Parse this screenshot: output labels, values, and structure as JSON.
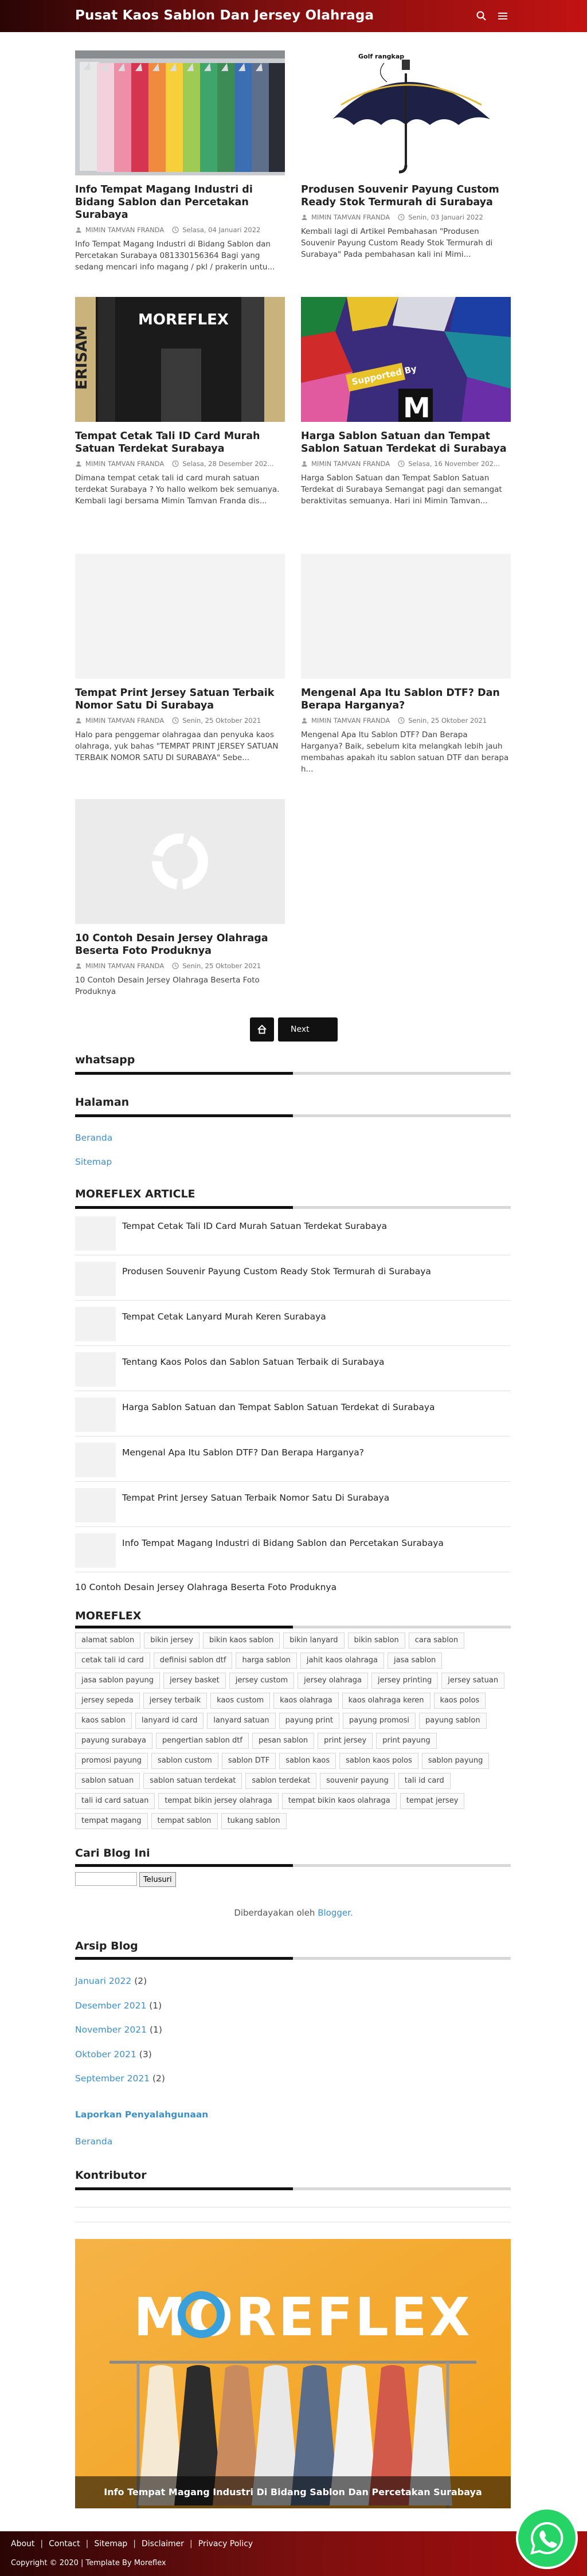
{
  "header": {
    "site_title": "Pusat Kaos Sablon Dan Jersey Olahraga"
  },
  "posts": [
    {
      "title": "Info Tempat Magang Industri di Bidang Sablon dan Percetakan Surabaya",
      "author": "MIMIN TAMVAN FRANDA",
      "date": "Selasa, 04 Januari 2022",
      "excerpt": "Info Tempat Magang Industri di Bidang Sablon dan Percetakan Surabaya 081330156364 Bagi yang sedang mencari info magang / pkl / prakerin untu..."
    },
    {
      "title": "Produsen Souvenir Payung Custom Ready Stok Termurah di Surabaya",
      "author": "MIMIN TAMVAN FRANDA",
      "date": "Senin, 03 Januari 2022",
      "excerpt": "Kembali lagi di Artikel Pembahasan \"Produsen Souvenir Payung Custom Ready Stok Termurah di Surabaya\" Pada pembahasan kali ini Mimi...",
      "image_text": "Golf rangkap"
    },
    {
      "title": "Tempat Cetak Tali ID Card Murah Satuan Terdekat Surabaya",
      "author": "MIMIN TAMVAN FRANDA",
      "date": "Selasa, 28 Desember 202...",
      "excerpt": "Dimana tempat cetak tali id card murah satuan terdekat Surabaya ? Yo hallo welkom bek semuanya. Kembali lagi bersama Mimin Tamvan Franda dis...",
      "image_text": "MOREFLEX"
    },
    {
      "title": "Harga Sablon Satuan dan Tempat Sablon Satuan Terdekat di Surabaya",
      "author": "MIMIN TAMVAN FRANDA",
      "date": "Selasa, 16 November 202...",
      "excerpt": "Harga Sablon Satuan dan Tempat Sablon Satuan Terdekat di Surabaya   Semangat pagi dan semangat beraktivitas semuanya. Hari ini Mimin Tamvan...",
      "image_text": "Supported By"
    },
    {
      "title": "Tempat Print Jersey Satuan Terbaik Nomor Satu Di Surabaya",
      "author": "MIMIN TAMVAN FRANDA",
      "date": "Senin, 25 Oktober 2021",
      "excerpt": "Halo para penggemar olahragaa dan penyuka kaos olahraga, yuk bahas \"TEMPAT PRINT JERSEY SATUAN TERBAIK NOMOR SATU DI SURABAYA\" Sebe..."
    },
    {
      "title": "Mengenal Apa Itu Sablon DTF? Dan Berapa Harganya?",
      "author": "MIMIN TAMVAN FRANDA",
      "date": "Senin, 25 Oktober 2021",
      "excerpt": "Mengenal Apa Itu Sablon DTF? Dan Berapa Harganya? Baik, sebelum kita melangkah lebih jauh membahas apakah itu sablon satuan DTF dan berapa h..."
    },
    {
      "title": "10 Contoh Desain Jersey Olahraga Beserta Foto Produknya",
      "author": "MIMIN TAMVAN FRANDA",
      "date": "Senin, 25 Oktober 2021",
      "excerpt": "10 Contoh Desain Jersey Olahraga Beserta Foto Produknya"
    }
  ],
  "pagination": {
    "next_label": "Next"
  },
  "widgets": {
    "whatsapp_title": "whatsapp",
    "halaman_title": "Halaman",
    "halaman_links": [
      "Beranda",
      "Sitemap"
    ],
    "article_title": "MOREFLEX ARTICLE",
    "articles": [
      "Tempat Cetak Tali ID Card Murah Satuan Terdekat Surabaya",
      "Produsen Souvenir Payung Custom Ready Stok Termurah di Surabaya",
      "Tempat Cetak Lanyard Murah Keren Surabaya",
      "Tentang Kaos Polos dan Sablon Satuan Terbaik di Surabaya",
      "Harga Sablon Satuan dan Tempat Sablon Satuan Terdekat di Surabaya",
      "Mengenal Apa Itu Sablon DTF? Dan Berapa Harganya?",
      "Tempat Print Jersey Satuan Terbaik Nomor Satu Di Surabaya",
      "Info Tempat Magang Industri di Bidang Sablon dan Percetakan Surabaya"
    ],
    "article_last": "10 Contoh Desain Jersey Olahraga Beserta Foto Produknya",
    "labels_title": "MOREFLEX",
    "labels": [
      "alamat sablon",
      "bikin jersey",
      "bikin kaos sablon",
      "bikin lanyard",
      "bikin sablon",
      "cara sablon",
      "cetak tali id card",
      "definisi sablon dtf",
      "harga sablon",
      "jahit kaos olahraga",
      "jasa sablon",
      "jasa sablon payung",
      "jersey basket",
      "jersey custom",
      "jersey olahraga",
      "jersey printing",
      "jersey satuan",
      "jersey sepeda",
      "jersey terbaik",
      "kaos custom",
      "kaos olahraga",
      "kaos olahraga keren",
      "kaos polos",
      "kaos sablon",
      "lanyard id card",
      "lanyard satuan",
      "payung print",
      "payung promosi",
      "payung sablon",
      "payung surabaya",
      "pengertian sablon dtf",
      "pesan sablon",
      "print jersey",
      "print payung",
      "promosi payung",
      "sablon custom",
      "sablon DTF",
      "sablon kaos",
      "sablon kaos polos",
      "sablon payung",
      "sablon satuan",
      "sablon satuan terdekat",
      "sablon terdekat",
      "souvenir payung",
      "tali id card",
      "tali id card satuan",
      "tempat bikin jersey olahraga",
      "tempat bikin kaos olahraga",
      "tempat jersey",
      "tempat magang",
      "tempat sablon",
      "tukang sablon"
    ],
    "search_title": "Cari Blog Ini",
    "search_button": "Telusuri",
    "powered_prefix": "Diberdayakan oleh",
    "powered_link": "Blogger.",
    "archive_title": "Arsip Blog",
    "archive": [
      {
        "month": "Januari 2022",
        "count": "(2)"
      },
      {
        "month": "Desember 2021",
        "count": "(1)"
      },
      {
        "month": "November 2021",
        "count": "(1)"
      },
      {
        "month": "Oktober 2021",
        "count": "(3)"
      },
      {
        "month": "September 2021",
        "count": "(2)"
      }
    ],
    "report_abuse": "Laporkan Penyalahgunaan",
    "beranda": "Beranda",
    "contributor_title": "Kontributor",
    "hero_logo": "MOREFLEX",
    "hero_caption": "Info Tempat Magang Industri Di Bidang Sablon Dan Percetakan Surabaya"
  },
  "footer": {
    "links": [
      "About",
      "Contact",
      "Sitemap",
      "Disclaimer",
      "Privacy Policy"
    ],
    "copyright": "Copyright © 2020 | Template By Moreflex"
  },
  "colors": {
    "header_dark": "#2a0505",
    "header_red": "#c31212",
    "link": "#3d8fc7",
    "whatsapp": "#25d366"
  }
}
